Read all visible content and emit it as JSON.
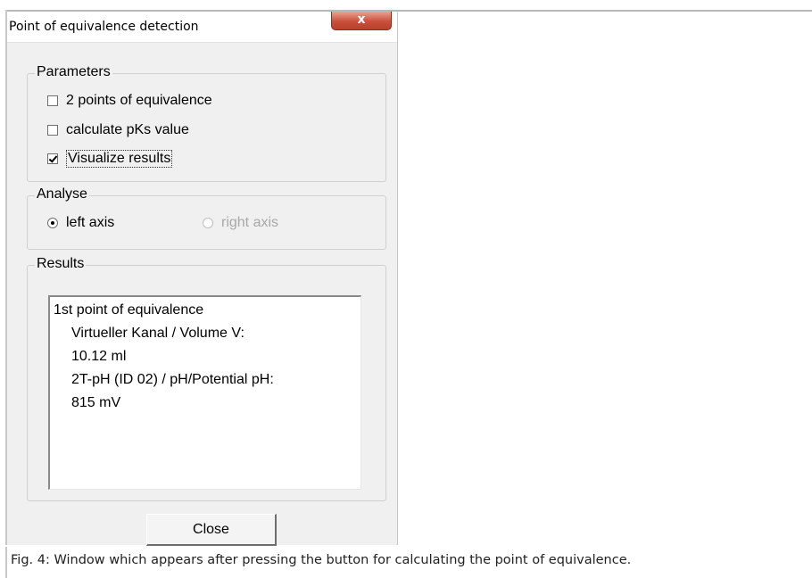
{
  "window": {
    "title": "Point of equivalence detection",
    "close_glyph": "x"
  },
  "parameters": {
    "label": "Parameters",
    "options": [
      {
        "label": "2 points of equivalence",
        "checked": false
      },
      {
        "label": "calculate pKs value",
        "checked": false
      },
      {
        "label": "Visualize results",
        "checked": true
      }
    ]
  },
  "analyse": {
    "label": "Analyse",
    "left_axis": {
      "label": "left axis",
      "selected": true,
      "enabled": true
    },
    "right_axis": {
      "label": "right axis",
      "selected": false,
      "enabled": false
    }
  },
  "results": {
    "label": "Results",
    "lines": [
      "1st point of equivalence",
      "Virtueller Kanal / Volume V:",
      "10.12 ml",
      "2T-pH (ID 02) / pH/Potential pH:",
      "815 mV"
    ]
  },
  "buttons": {
    "close": "Close"
  },
  "caption": "Fig. 4: Window which appears after pressing the button for calculating the point of equivalence."
}
